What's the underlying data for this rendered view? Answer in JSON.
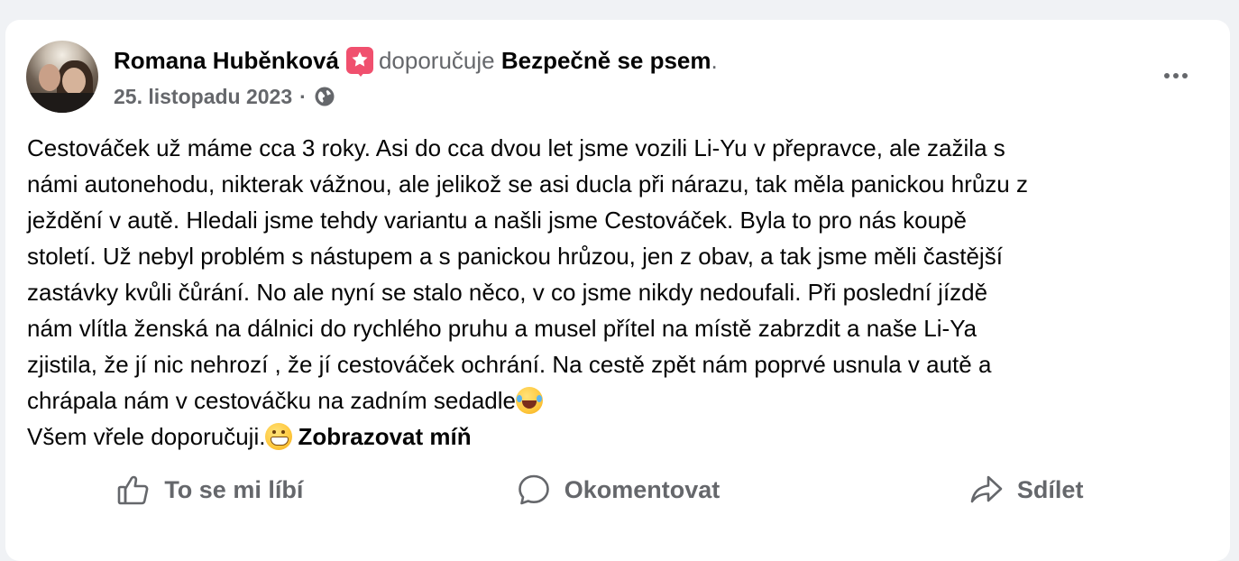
{
  "post": {
    "author": "Romana Huběnková",
    "verb": "doporučuje",
    "page": "Bezpečně se psem",
    "end_punct": ".",
    "date": "25. listopadu 2023",
    "separator": "·",
    "privacy_icon": "globe-icon",
    "recommend_icon": "star-recommend-icon",
    "more_icon": "more-options-icon",
    "body_lines": [
      "Cestováček už máme cca 3 roky. Asi do cca dvou let jsme vozili Li-Yu v přepravce, ale zažila s",
      "námi autonehodu, nikterak vážnou, ale jelikož se asi ducla při nárazu, tak měla panickou hrůzu z",
      "ježdění v autě. Hledali jsme tehdy variantu a našli jsme Cestováček. Byla to pro nás koupě",
      "století. Už nebyl problém s nástupem a s panickou hrůzou, jen z obav, a tak jsme měli častější",
      "zastávky kvůli čůrání. No ale nyní se stalo něco, v co jsme nikdy nedoufali. Při poslední jízdě",
      "nám vlítla ženská na dálnici do rychlého pruhu a musel přítel na místě zabrzdit a naše Li-Ya",
      "zjistila, že jí nic nehrozí , že jí cestováček ochrání. Na cestě zpět nám poprvé usnula v autě a",
      "chrápala nám v cestováčku na zadním sedadle"
    ],
    "last_line": "Všem vřele doporučuji.",
    "emoji_1": "laughing-tears-emoji",
    "emoji_2": "grinning-emoji",
    "see_less": "Zobrazovat míň"
  },
  "actions": {
    "like": "To se mi líbí",
    "comment": "Okomentovat",
    "share": "Sdílet"
  },
  "colors": {
    "background": "#f0f2f5",
    "card": "#ffffff",
    "secondary_text": "#65676b",
    "primary_text": "#050505",
    "badge": "#f0506e"
  }
}
